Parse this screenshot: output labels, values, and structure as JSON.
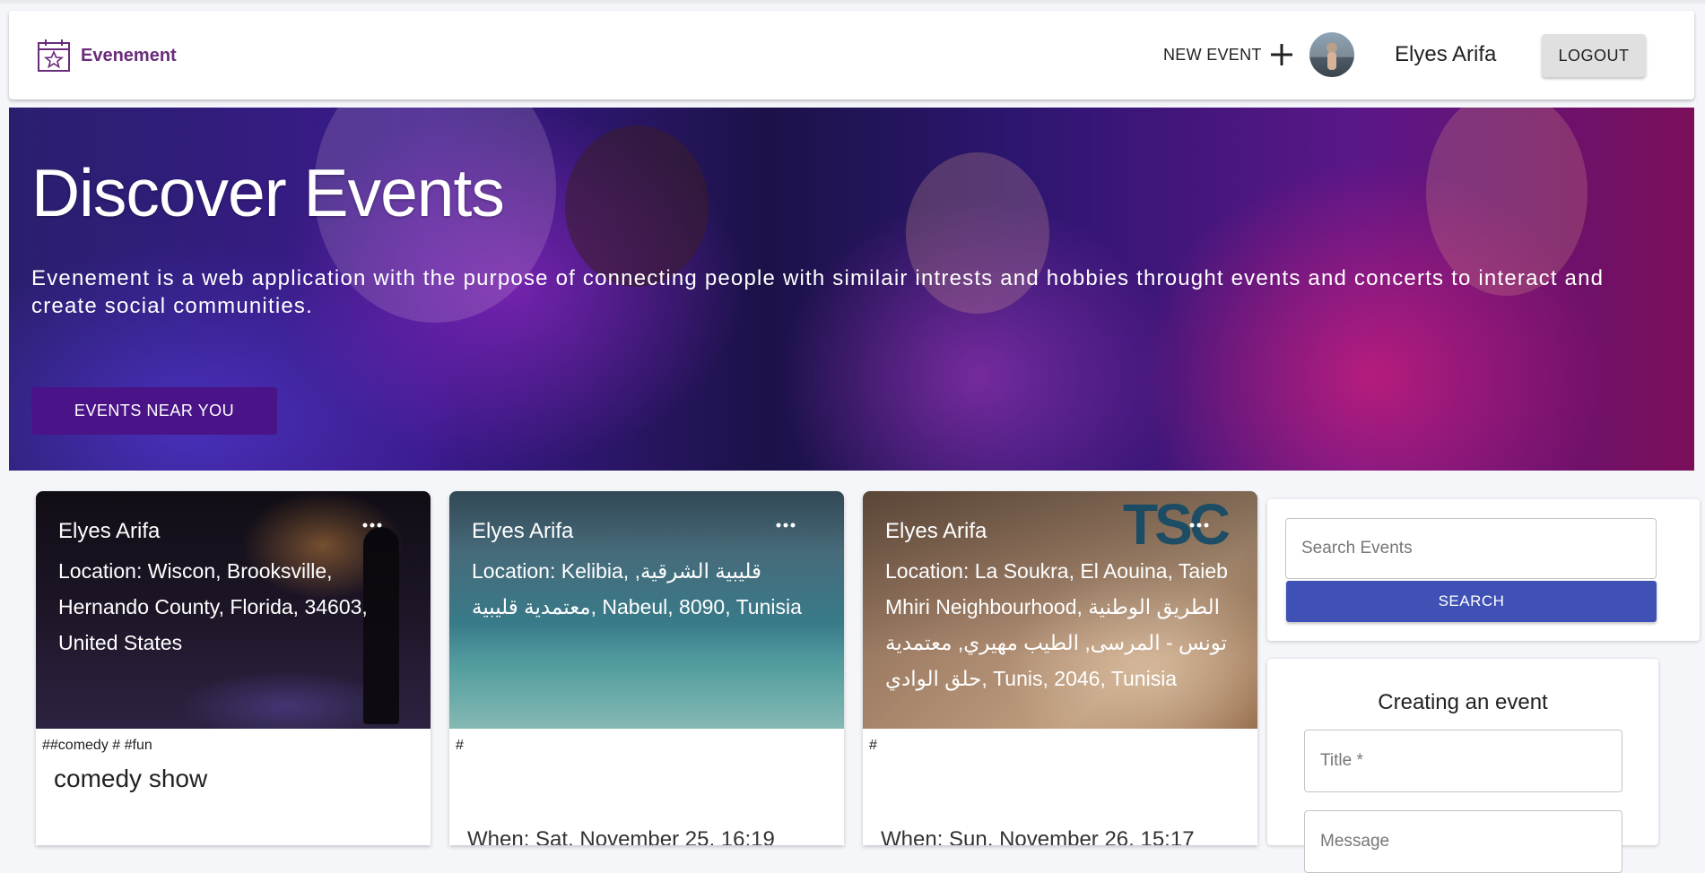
{
  "navbar": {
    "brand": "Evenement",
    "new_event_label": "NEW EVENT",
    "user_name": "Elyes Arifa",
    "logout_label": "LOGOUT"
  },
  "hero": {
    "title": "Discover Events",
    "description": "Evenement is a web application with the purpose of connecting people with similair intrests and hobbies throught events and concerts to interact and create social communities.",
    "button_label": "EVENTS NEAR YOU"
  },
  "cards": [
    {
      "author": "Elyes Arifa",
      "location": "Location: Wiscon, Brooksville, Hernando County, Florida, 34603, United States",
      "tags": "##comedy # #fun",
      "title": "comedy show",
      "when": ""
    },
    {
      "author": "Elyes Arifa",
      "location": "Location: Kelibia, قليبية الشرقية, معتمدية قليبية, Nabeul, 8090, Tunisia",
      "tags": "#",
      "title": "",
      "when": "When: Sat, November 25, 16:19"
    },
    {
      "author": "Elyes Arifa",
      "location": "Location: La Soukra, El Aouina, Taieb Mhiri Neighbourhood, الطريق الوطنية تونس - المرسى, الطيب مهيري, معتمدية حلق الوادي, Tunis, 2046, Tunisia",
      "tags": "#",
      "title": "",
      "when": "When: Sun, November 26, 15:17",
      "logo_text": "TSC"
    }
  ],
  "search": {
    "placeholder": "Search Events",
    "button_label": "SEARCH"
  },
  "create": {
    "title": "Creating an event",
    "title_placeholder": "Title *",
    "message_placeholder": "Message"
  },
  "colors": {
    "brand": "#6a2c7a",
    "hero_button": "#4a1488",
    "search_button": "#3f51b5"
  }
}
